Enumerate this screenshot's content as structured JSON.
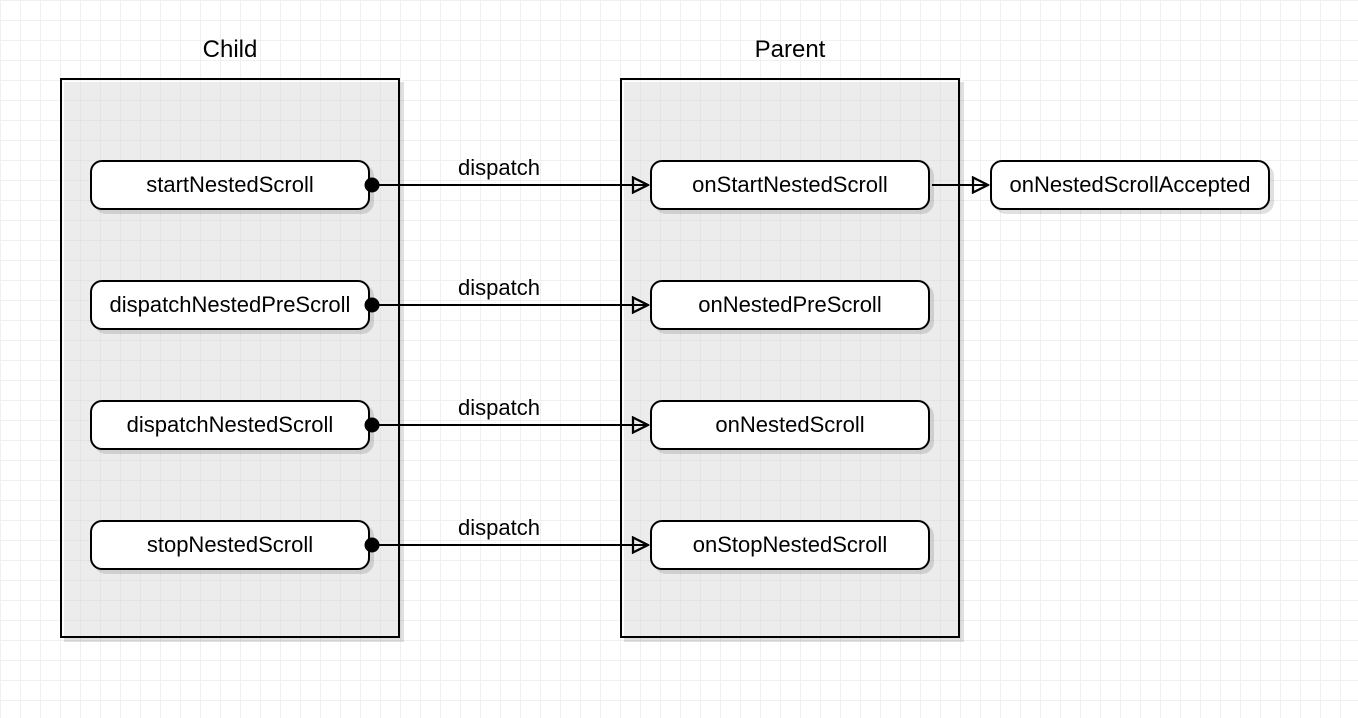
{
  "containers": {
    "child": {
      "title": "Child"
    },
    "parent": {
      "title": "Parent"
    }
  },
  "nodes": {
    "startNestedScroll": "startNestedScroll",
    "dispatchNestedPreScroll": "dispatchNestedPreScroll",
    "dispatchNestedScroll": "dispatchNestedScroll",
    "stopNestedScroll": "stopNestedScroll",
    "onStartNestedScroll": "onStartNestedScroll",
    "onNestedPreScroll": "onNestedPreScroll",
    "onNestedScroll": "onNestedScroll",
    "onStopNestedScroll": "onStopNestedScroll",
    "onNestedScrollAccepted": "onNestedScrollAccepted"
  },
  "edges": {
    "d1": "dispatch",
    "d2": "dispatch",
    "d3": "dispatch",
    "d4": "dispatch"
  }
}
